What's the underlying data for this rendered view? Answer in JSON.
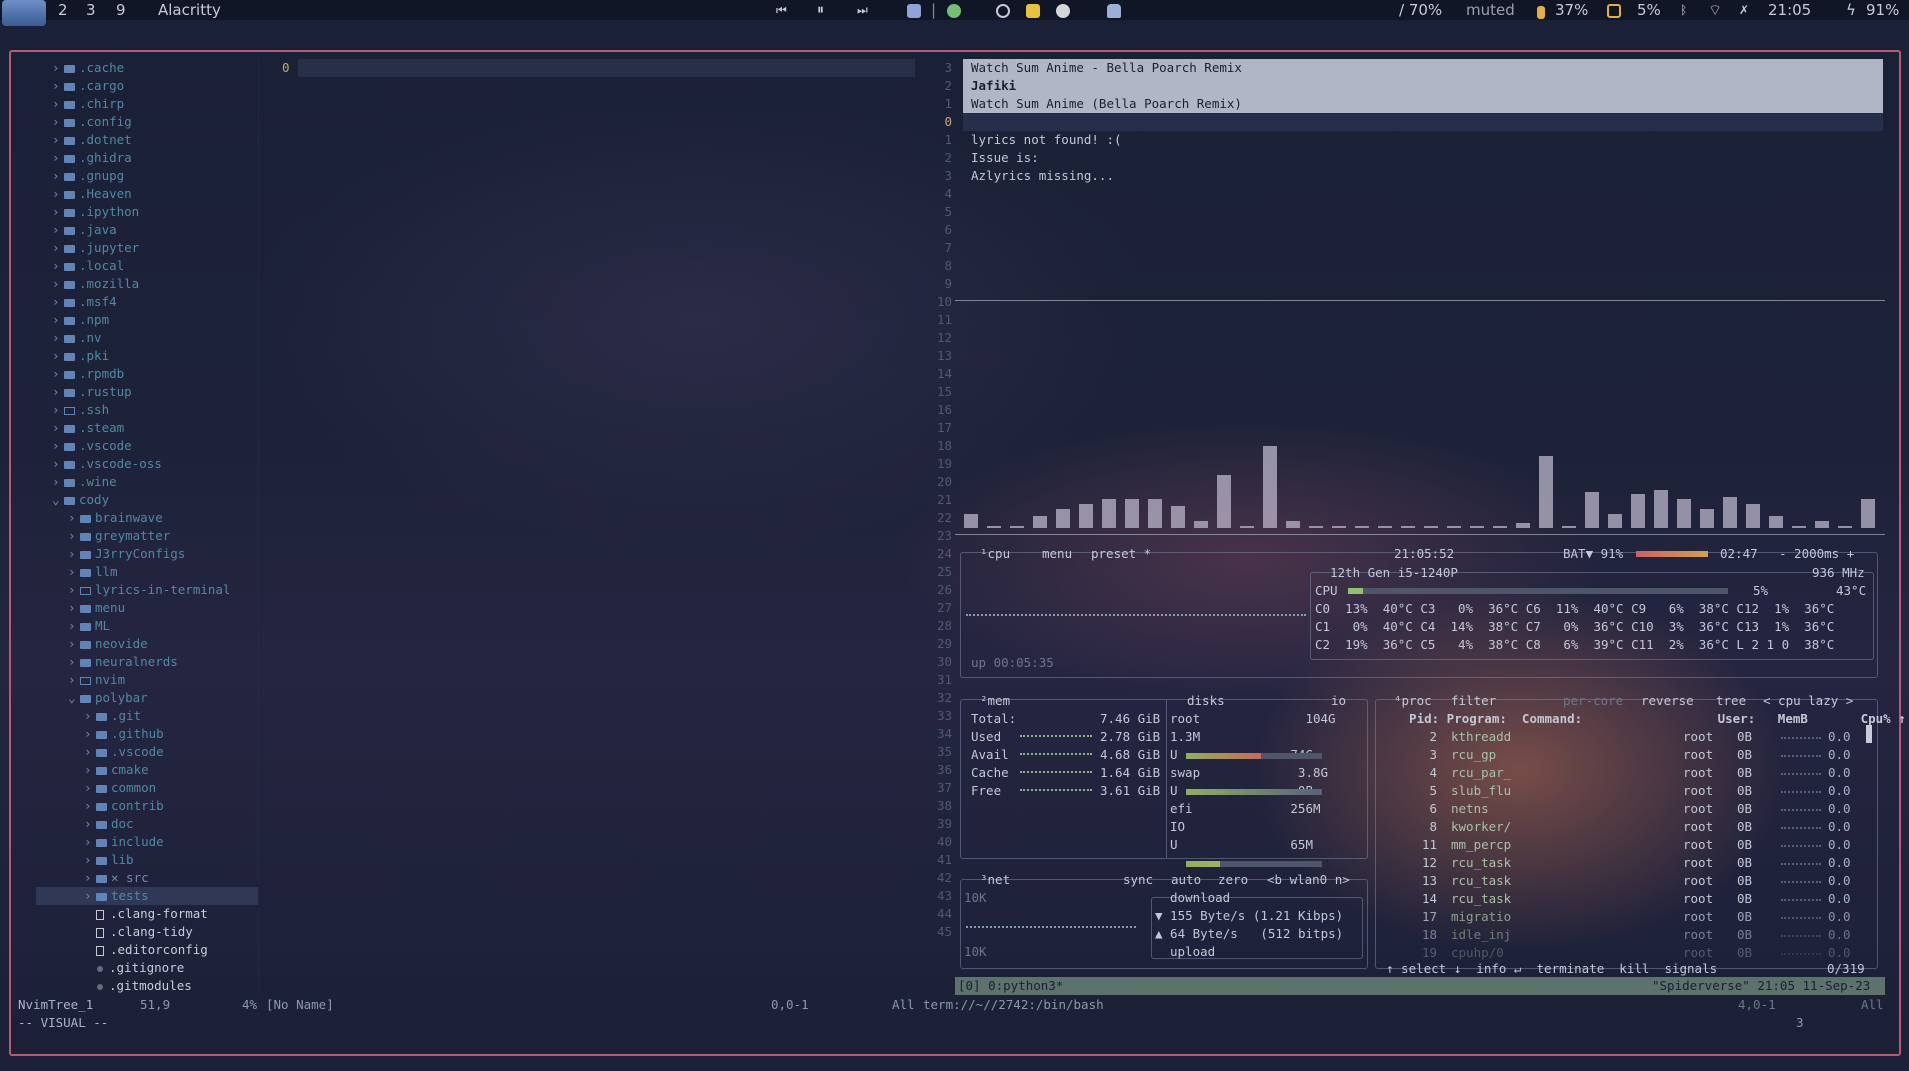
{
  "bar": {
    "workspaces": [
      "2",
      "3",
      "9"
    ],
    "window_title": "Alacritty",
    "volume": "/ 70%",
    "mic": "muted",
    "battery": "37%",
    "cpu": "5%",
    "clock": "21:05",
    "charge": "91%"
  },
  "tree": {
    "items": [
      {
        "name": ".cache",
        "depth": 0,
        "kind": "closed"
      },
      {
        "name": ".cargo",
        "depth": 0,
        "kind": "closed"
      },
      {
        "name": ".chirp",
        "depth": 0,
        "kind": "closed"
      },
      {
        "name": ".config",
        "depth": 0,
        "kind": "closed"
      },
      {
        "name": ".dotnet",
        "depth": 0,
        "kind": "closed"
      },
      {
        "name": ".ghidra",
        "depth": 0,
        "kind": "closed"
      },
      {
        "name": ".gnupg",
        "depth": 0,
        "kind": "closed"
      },
      {
        "name": ".Heaven",
        "depth": 0,
        "kind": "closed"
      },
      {
        "name": ".ipython",
        "depth": 0,
        "kind": "closed"
      },
      {
        "name": ".java",
        "depth": 0,
        "kind": "closed"
      },
      {
        "name": ".jupyter",
        "depth": 0,
        "kind": "closed"
      },
      {
        "name": ".local",
        "depth": 0,
        "kind": "closed"
      },
      {
        "name": ".mozilla",
        "depth": 0,
        "kind": "closed"
      },
      {
        "name": ".msf4",
        "depth": 0,
        "kind": "closed"
      },
      {
        "name": ".npm",
        "depth": 0,
        "kind": "closed"
      },
      {
        "name": ".nv",
        "depth": 0,
        "kind": "closed"
      },
      {
        "name": ".pki",
        "depth": 0,
        "kind": "closed"
      },
      {
        "name": ".rpmdb",
        "depth": 0,
        "kind": "closed"
      },
      {
        "name": ".rustup",
        "depth": 0,
        "kind": "closed"
      },
      {
        "name": ".ssh",
        "depth": 0,
        "kind": "empty"
      },
      {
        "name": ".steam",
        "depth": 0,
        "kind": "closed"
      },
      {
        "name": ".vscode",
        "depth": 0,
        "kind": "closed"
      },
      {
        "name": ".vscode-oss",
        "depth": 0,
        "kind": "closed"
      },
      {
        "name": ".wine",
        "depth": 0,
        "kind": "closed"
      },
      {
        "name": "cody",
        "depth": 0,
        "kind": "open"
      },
      {
        "name": "brainwave",
        "depth": 1,
        "kind": "closed"
      },
      {
        "name": "greymatter",
        "depth": 1,
        "kind": "closed"
      },
      {
        "name": "J3rryConfigs",
        "depth": 1,
        "kind": "closed"
      },
      {
        "name": "llm",
        "depth": 1,
        "kind": "closed"
      },
      {
        "name": "lyrics-in-terminal",
        "depth": 1,
        "kind": "empty"
      },
      {
        "name": "menu",
        "depth": 1,
        "kind": "closed"
      },
      {
        "name": "ML",
        "depth": 1,
        "kind": "closed"
      },
      {
        "name": "neovide",
        "depth": 1,
        "kind": "closed"
      },
      {
        "name": "neuralnerds",
        "depth": 1,
        "kind": "closed"
      },
      {
        "name": "nvim",
        "depth": 1,
        "kind": "empty"
      },
      {
        "name": "polybar",
        "depth": 1,
        "kind": "open"
      },
      {
        "name": ".git",
        "depth": 2,
        "kind": "closed"
      },
      {
        "name": ".github",
        "depth": 2,
        "kind": "closed"
      },
      {
        "name": ".vscode",
        "depth": 2,
        "kind": "closed"
      },
      {
        "name": "cmake",
        "depth": 2,
        "kind": "closed"
      },
      {
        "name": "common",
        "depth": 2,
        "kind": "closed"
      },
      {
        "name": "contrib",
        "depth": 2,
        "kind": "closed"
      },
      {
        "name": "doc",
        "depth": 2,
        "kind": "closed"
      },
      {
        "name": "include",
        "depth": 2,
        "kind": "closed"
      },
      {
        "name": "lib",
        "depth": 2,
        "kind": "closed"
      },
      {
        "name": "✕ src",
        "depth": 2,
        "kind": "closed"
      },
      {
        "name": "tests",
        "depth": 2,
        "kind": "closed"
      },
      {
        "name": ".clang-format",
        "depth": 2,
        "kind": "file"
      },
      {
        "name": ".clang-tidy",
        "depth": 2,
        "kind": "file"
      },
      {
        "name": ".editorconfig",
        "depth": 2,
        "kind": "file"
      },
      {
        "name": ".gitignore",
        "depth": 2,
        "kind": "dot"
      },
      {
        "name": ".gitmodules",
        "depth": 2,
        "kind": "dot"
      }
    ]
  },
  "editor": {
    "line_number": "0"
  },
  "lyrics": {
    "header_nums": [
      "3",
      "2",
      "1"
    ],
    "header": [
      "Watch Sum Anime - Bella Poarch Remix",
      "Jafiki",
      "Watch Sum Anime (Bella Poarch Remix)"
    ],
    "cursor_num": "0",
    "body": [
      "lyrics not found! :(",
      "Issue is:",
      "Azlyrics missing..."
    ]
  },
  "visualizer": {
    "heights": [
      12,
      2,
      2,
      10,
      16,
      20,
      24,
      24,
      24,
      18,
      6,
      44,
      2,
      68,
      6,
      2,
      2,
      2,
      2,
      2,
      2,
      2,
      2,
      2,
      4,
      60,
      2,
      30,
      12,
      28,
      32,
      24,
      16,
      26,
      20,
      10,
      2,
      6,
      2,
      24
    ]
  },
  "btop": {
    "cpu": {
      "label": "cpu",
      "menu": "menu",
      "preset": "preset *",
      "clock": "21:05:52",
      "bat": "BAT▼ 91%",
      "bat_time": "02:47",
      "interval": "- 2000ms +",
      "model": "12th Gen i5-1240P",
      "freq": "936 MHz",
      "total_label": "CPU",
      "total_pct": "5%",
      "total_temp": "43°C",
      "uptime": "up 00:05:35",
      "cores": [
        "C0  13%  40°C C3   0%  36°C C6  11%  40°C C9   6%  38°C C12  1%  36°C",
        "C1   0%  40°C C4  14%  38°C C7   0%  36°C C10  3%  36°C C13  1%  36°C",
        "C2  19%  36°C C5   4%  38°C C8   6%  39°C C11  2%  36°C L 2 1 0  38°C"
      ]
    },
    "mem": {
      "label": "mem",
      "rows": [
        [
          "Total:",
          "7.46 GiB"
        ],
        [
          "Used",
          "2.78 GiB"
        ],
        [
          "Avail",
          "4.68 GiB"
        ],
        [
          "Cache",
          "1.64 GiB"
        ],
        [
          "Free",
          "3.61 GiB"
        ]
      ]
    },
    "disks": {
      "label": "disks",
      "io": "io",
      "lines": [
        "root              104G",
        "1.3M",
        "U               74G",
        "swap             3.8G",
        "U                0B",
        "efi             256M",
        "IO",
        "U               65M"
      ]
    },
    "net": {
      "label": "net",
      "sync": "sync",
      "auto": "auto",
      "zero": "zero",
      "iface": "<b wlan0 n>",
      "top": "10K",
      "bottom": "10K",
      "download": "download",
      "dl1": "▼ 155 Byte/s (1.21 Kibps)",
      "dl2": "▲ 64 Byte/s   (512 bitps)",
      "upload": "upload"
    },
    "proc": {
      "label": "proc",
      "filter": "filter",
      "percore": "per-core",
      "reverse": "reverse",
      "tree": "tree",
      "cpulazy": "< cpu lazy >",
      "header": "  Pid: Program:  Command:                  User:   MemB       Cpu% ↑",
      "rows": [
        [
          "2",
          "kthreadd",
          "root",
          "0B",
          "0.0"
        ],
        [
          "3",
          "rcu_gp",
          "root",
          "0B",
          "0.0"
        ],
        [
          "4",
          "rcu_par_",
          "root",
          "0B",
          "0.0"
        ],
        [
          "5",
          "slub_flu",
          "root",
          "0B",
          "0.0"
        ],
        [
          "6",
          "netns",
          "root",
          "0B",
          "0.0"
        ],
        [
          "8",
          "kworker/",
          "root",
          "0B",
          "0.0"
        ],
        [
          "11",
          "mm_percp",
          "root",
          "0B",
          "0.0"
        ],
        [
          "12",
          "rcu_task",
          "root",
          "0B",
          "0.0"
        ],
        [
          "13",
          "rcu_task",
          "root",
          "0B",
          "0.0"
        ],
        [
          "14",
          "rcu_task",
          "root",
          "0B",
          "0.0"
        ],
        [
          "17",
          "migratio",
          "root",
          "0B",
          "0.0"
        ],
        [
          "18",
          "idle_inj",
          "root",
          "0B",
          "0.0"
        ],
        [
          "19",
          "cpuhp/0",
          "root",
          "0B",
          "0.0"
        ]
      ],
      "footer": "↑ select ↓  info ↵  terminate  kill  signals",
      "count": "0/319"
    }
  },
  "tmux": {
    "left": "[0] 0:python3*",
    "right": "\"Spiderverse\" 21:05 11-Sep-23"
  },
  "status": {
    "tree": "NvimTree_1",
    "tree_pos": "51,9",
    "tree_pct": "4%",
    "noname": "[No Name]",
    "pos": "0,0-1",
    "all": "All",
    "term": "term://~//2742:/bin/bash",
    "term_pos": "4,0-1",
    "term_all": "All",
    "mode": "-- VISUAL --",
    "count": "3"
  },
  "colors": {
    "frame": "#b65a72",
    "tree_text": "#4d8aa6",
    "folder": "#5f84b7"
  }
}
